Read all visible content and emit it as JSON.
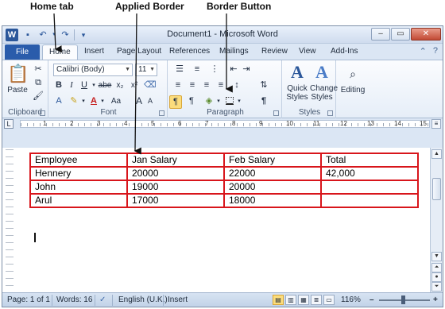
{
  "annotations": {
    "home_tab": "Home tab",
    "applied_border": "Applied Border",
    "border_button": "Border Button"
  },
  "window": {
    "title": "Document1 - Microsoft Word",
    "app_icon": "W",
    "controls": {
      "minimize": "–",
      "restore": "▭",
      "close": "✕"
    }
  },
  "ribbon_tabs": {
    "file": "File",
    "items": [
      "Home",
      "Insert",
      "Page Layout",
      "References",
      "Mailings",
      "Review",
      "View",
      "Add-Ins"
    ],
    "active": "Home"
  },
  "clipboard": {
    "paste_label": "Paste",
    "group_label": "Clipboard"
  },
  "font": {
    "font_name": "Calibri (Body)",
    "font_size": "11",
    "bold": "B",
    "italic": "I",
    "underline": "U",
    "strike": "abe",
    "subscript": "x₂",
    "superscript": "x²",
    "grow": "A",
    "shrink": "A",
    "font_color": "A",
    "change_case": "Aa",
    "group_label": "Font"
  },
  "paragraph": {
    "pilcrow": "¶",
    "group_label": "Paragraph"
  },
  "styles": {
    "quick_styles": "Quick Styles",
    "change_styles": "Change Styles",
    "group_label": "Styles"
  },
  "editing": {
    "label": "Editing"
  },
  "ruler": {
    "numbers": [
      "1",
      "2",
      "3",
      "4",
      "5",
      "6",
      "7",
      "8",
      "9",
      "10",
      "11",
      "12",
      "13",
      "14",
      "15"
    ]
  },
  "table": {
    "rows": [
      [
        "Employee",
        "Jan Salary",
        "Feb Salary",
        "Total"
      ],
      [
        "Hennery",
        "20000",
        "22000",
        "42,000"
      ],
      [
        "John",
        "19000",
        "20000",
        ""
      ],
      [
        "Arul",
        "17000",
        "18000",
        ""
      ]
    ]
  },
  "status": {
    "page": "Page: 1 of 1",
    "words": "Words: 16",
    "language": "English (U.K.)",
    "mode": "Insert",
    "zoom": "116%"
  }
}
